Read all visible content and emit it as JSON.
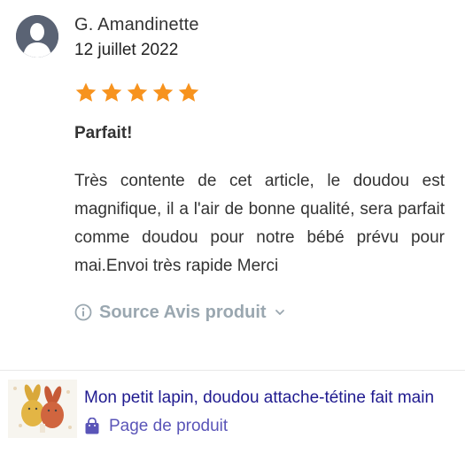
{
  "review": {
    "author": "G. Amandinette",
    "date": "12 juillet 2022",
    "rating": 5,
    "rating_max": 5,
    "title": "Parfait!",
    "body": "Très contente de cet article, le doudou est magnifique, il a l'air de bonne qualité, sera parfait comme doudou pour notre bébé prévu pour mai.Envoi très rapide Merci",
    "source_label": "Source Avis produit",
    "star_color": "#f7931e"
  },
  "product": {
    "name": "Mon petit lapin, doudou attache-tétine fait main",
    "page_link_label": "Page de produit",
    "link_color": "#1f1a8f"
  },
  "icons": {
    "avatar": "user-silhouette-icon",
    "source": "info-icon",
    "dropdown": "chevron-down-icon",
    "product_page": "shopping-bag-icon"
  }
}
